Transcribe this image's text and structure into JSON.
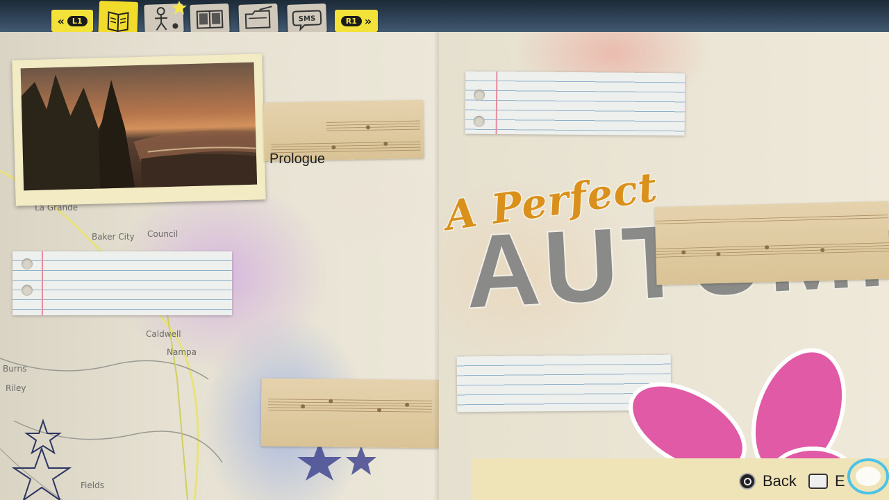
{
  "nav": {
    "left_bumper": "L1",
    "right_bumper": "R1",
    "tabs": [
      {
        "id": "journal",
        "icon": "journal-book-icon",
        "active": true
      },
      {
        "id": "characters",
        "icon": "stick-figure-icon",
        "active": false,
        "badge": "star"
      },
      {
        "id": "collectibles",
        "icon": "photo-album-icon",
        "active": false
      },
      {
        "id": "documents",
        "icon": "folder-icon",
        "active": false
      },
      {
        "id": "sms",
        "icon": "speech-bubble-icon",
        "label": "SMS",
        "active": false
      }
    ]
  },
  "left_page": {
    "chapter": {
      "name": "Prologue"
    },
    "map_labels": [
      "La Grande",
      "Baker City",
      "Council",
      "Caldwell",
      "Nampa",
      "Burns",
      "Riley",
      "Fields"
    ]
  },
  "right_page": {
    "title_line1": "A Perfect",
    "title_line2": "AUTUMN"
  },
  "prompts": {
    "back_label": "Back",
    "next_label": "E"
  },
  "colors": {
    "bumper_yellow": "#f3e23a",
    "active_tab": "#f1dc2c",
    "title_orange": "#d9911c",
    "title_gray": "#8a8a88",
    "flower_pink": "#e05aa5",
    "note_margin": "#e58ca0"
  }
}
